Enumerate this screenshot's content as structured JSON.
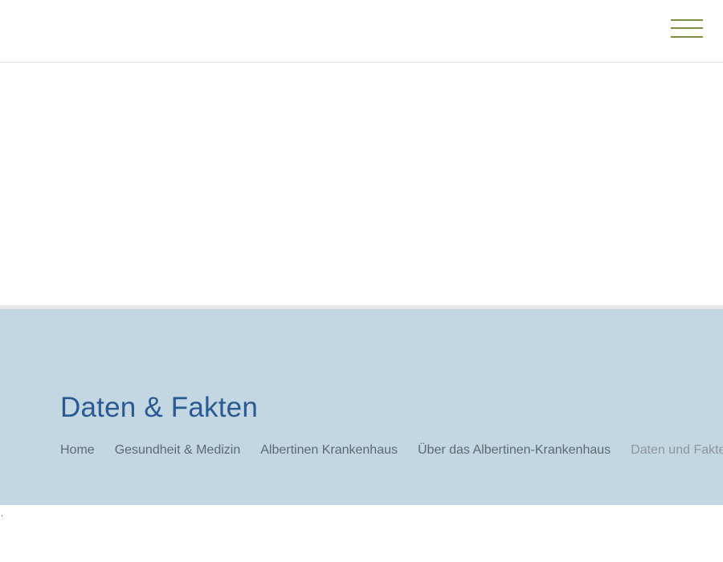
{
  "header": {
    "menu_icon": "hamburger-menu-icon",
    "accent_color": "#7a8f3f"
  },
  "title_band": {
    "title": "Daten & Fakten",
    "background_color": "#c3d7e3",
    "title_color": "#2b5a93"
  },
  "breadcrumb": {
    "items": [
      {
        "label": "Home"
      },
      {
        "label": "Gesundheit & Medizin"
      },
      {
        "label": "Albertinen Krankenhaus"
      },
      {
        "label": "Über das Albertinen-Krankenhaus"
      },
      {
        "label": "Daten und Fakten"
      }
    ]
  },
  "footer": {
    "stray_mark": "."
  }
}
